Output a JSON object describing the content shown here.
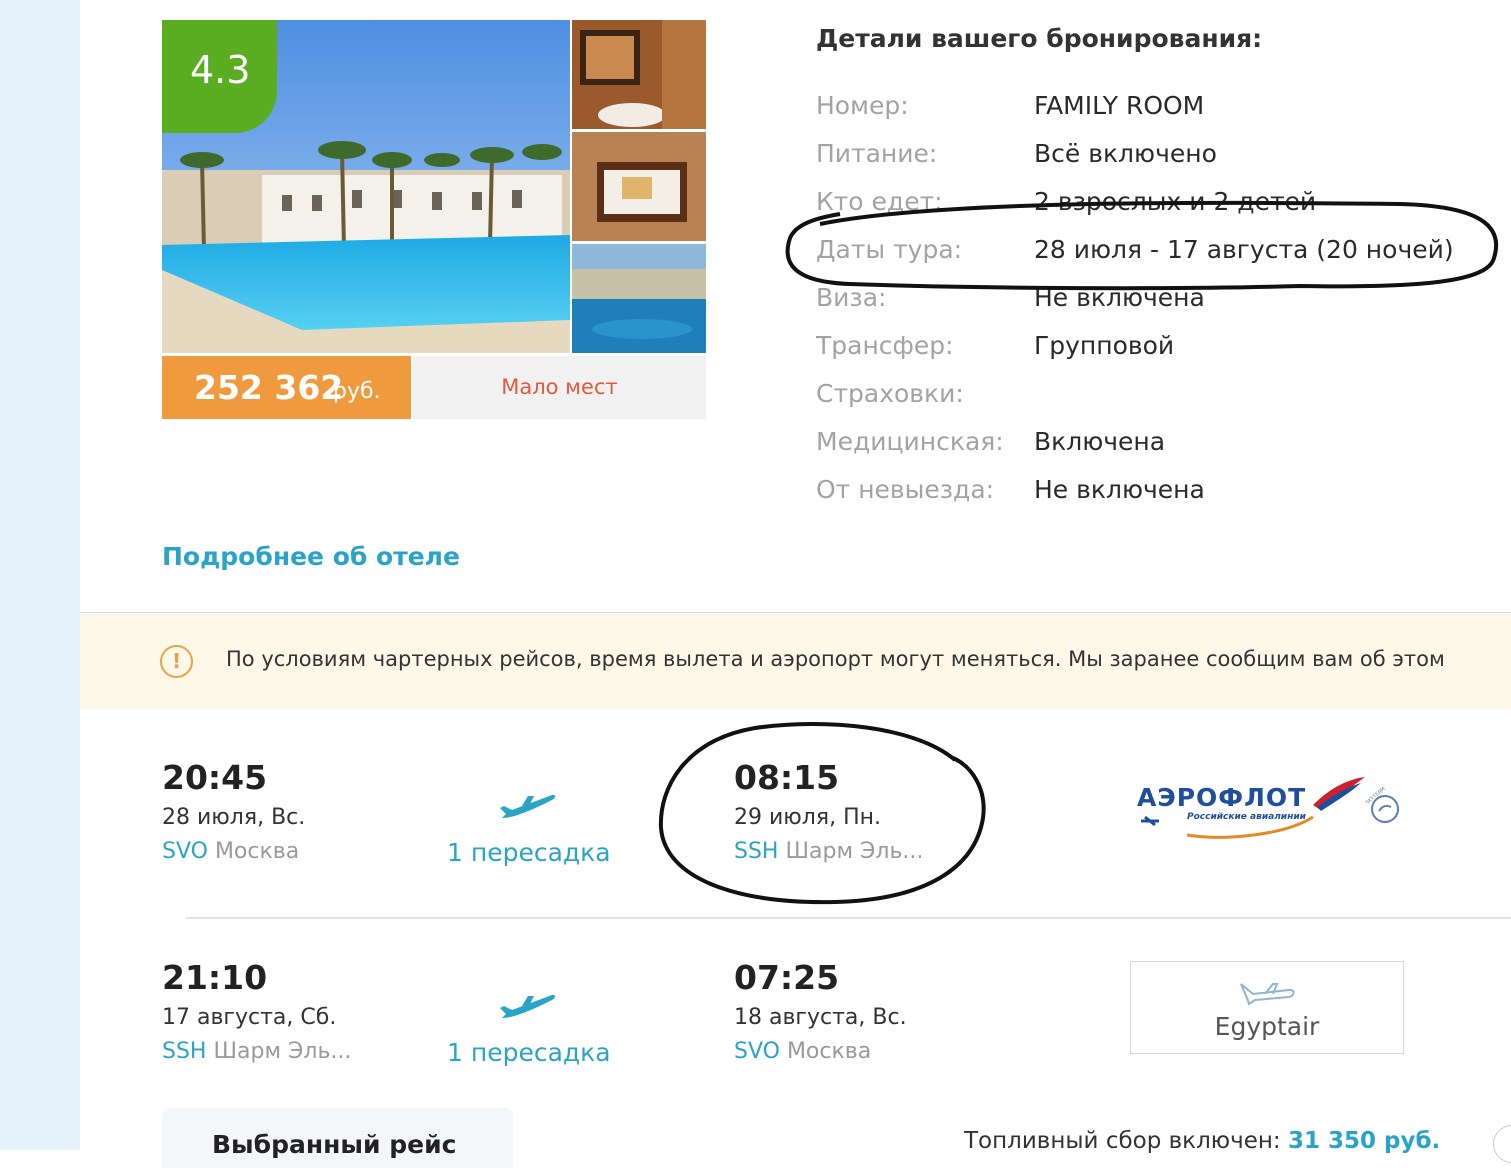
{
  "hotel": {
    "rating": "4.3",
    "price_value": "252 362",
    "price_currency": "руб.",
    "availability": "Мало мест",
    "more_link": "Подробнее об отеле"
  },
  "details": {
    "title": "Детали вашего бронирования:",
    "rows": [
      {
        "label": "Номер:",
        "value": "FAMILY ROOM"
      },
      {
        "label": "Питание:",
        "value": "Всё включено"
      },
      {
        "label": "Кто едет:",
        "value": "2 взрослых и 2 детей"
      },
      {
        "label": "Даты тура:",
        "value": "28 июля - 17 августа (20 ночей)"
      },
      {
        "label": "Виза:",
        "value": "Не включена"
      },
      {
        "label": "Трансфер:",
        "value": "Групповой"
      },
      {
        "label": "Страховки:",
        "value": ""
      },
      {
        "label": "Медицинская:",
        "value": "Включена"
      },
      {
        "label": "От невыезда:",
        "value": "Не включена"
      }
    ]
  },
  "notice": {
    "icon": "warning-circle-icon",
    "text": "По условиям чартерных рейсов, время вылета и аэропорт могут меняться. Мы заранее сообщим вам об этом"
  },
  "flights": [
    {
      "dep_time": "20:45",
      "dep_date": "28 июля, Вс.",
      "dep_code": "SVO",
      "dep_city": "Москва",
      "transfer": "1 пересадка",
      "arr_time": "08:15",
      "arr_date": "29 июля, Пн.",
      "arr_code": "SSH",
      "arr_city": "Шарм Эль...",
      "airline_text": "АЭРОФЛОТ",
      "airline_sub": "Российские авиалинии",
      "airline_badge": "SKYTEAM"
    },
    {
      "dep_time": "21:10",
      "dep_date": "17 августа, Сб.",
      "dep_code": "SSH",
      "dep_city": "Шарм Эль...",
      "transfer": "1 пересадка",
      "arr_time": "07:25",
      "arr_date": "18 августа, Вс.",
      "arr_code": "SVO",
      "arr_city": "Москва",
      "airline_text": "Egyptair"
    }
  ],
  "footer": {
    "selected_tab": "Выбранный рейс",
    "fuel_label": "Топливный сбор включен:",
    "fuel_amount": "31 350 руб."
  },
  "colors": {
    "accent": "#2aa4c6",
    "rating_green": "#5aac20",
    "price_orange": "#ef9a3c",
    "availability_red": "#e25a3d",
    "notice_bg": "#fef8e8"
  }
}
